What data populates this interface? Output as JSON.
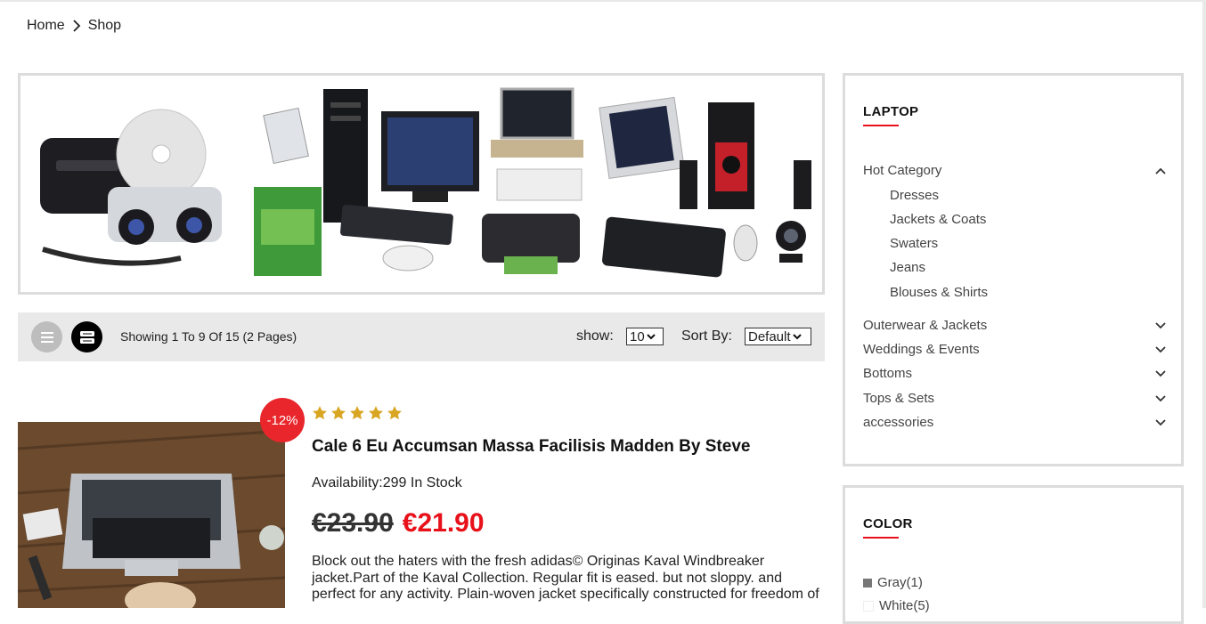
{
  "breadcrumb": {
    "home": "Home",
    "current": "Shop"
  },
  "toolbar": {
    "showing_text": "Showing 1 To 9 Of 15 (2 Pages)",
    "show_label": "show:",
    "show_value": "10",
    "sort_label": "Sort By:",
    "sort_value": "Default",
    "list_view_icon": "list-icon",
    "grid_view_icon": "grid-icon"
  },
  "product": {
    "badge": "-12%",
    "rating": 5,
    "rating_max": 5,
    "title": "Cale 6 Eu Accumsan Massa Facilisis Madden By Steve",
    "availability": "Availability:299 In Stock",
    "old_price": "€23.90",
    "new_price": "€21.90",
    "description": "Block out the haters with the fresh adidas© Originas Kaval Windbreaker jacket.Part of the Kaval Collection. Regular fit is eased. but not sloppy. and perfect for any activity. Plain-woven jacket specifically constructed for freedom of"
  },
  "sidebar": {
    "laptop": {
      "title": "LAPTOP",
      "categories": [
        {
          "label": "Hot Category",
          "expanded": true,
          "children": [
            "Dresses",
            "Jackets & Coats",
            "Swaters",
            "Jeans",
            "Blouses & Shirts"
          ]
        },
        {
          "label": "Outerwear & Jackets",
          "expanded": false
        },
        {
          "label": "Weddings & Events",
          "expanded": false
        },
        {
          "label": "Bottoms",
          "expanded": false
        },
        {
          "label": "Tops & Sets",
          "expanded": false
        },
        {
          "label": "accessories",
          "expanded": false
        }
      ]
    },
    "color": {
      "title": "COLOR",
      "items": [
        {
          "label": "Gray(1)",
          "swatch": "#777777"
        },
        {
          "label": "White(5)",
          "swatch": "#ffffff"
        }
      ]
    }
  },
  "colors": {
    "accent_red": "#e8111a",
    "badge_red": "#e8262b",
    "star_gold": "#d9a623",
    "toolbar_bg": "#e9e9e9"
  }
}
